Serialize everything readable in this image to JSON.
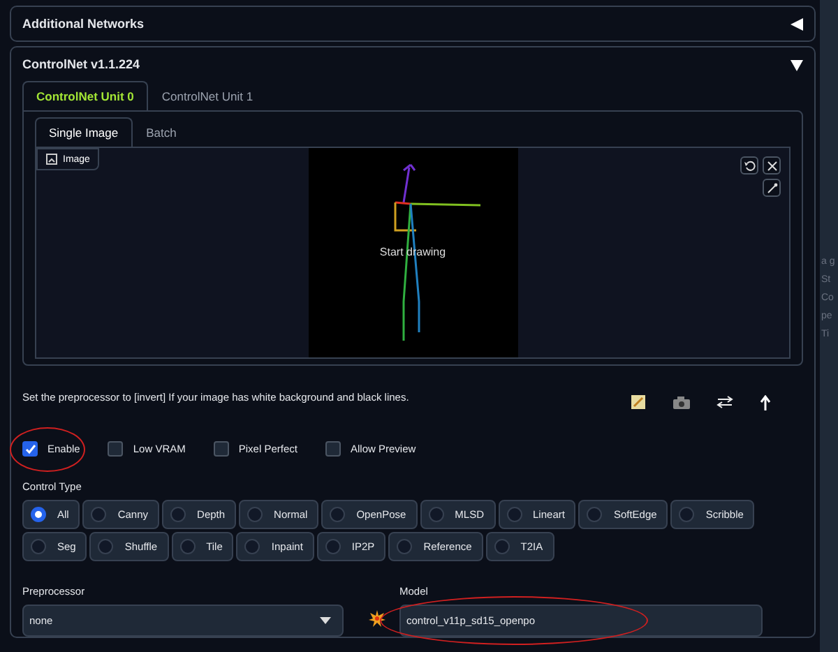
{
  "accordions": [
    {
      "title": "Additional Networks",
      "expanded": false
    },
    {
      "title": "ControlNet v1.1.224",
      "expanded": true
    }
  ],
  "unit_tabs": [
    {
      "label": "ControlNet Unit 0",
      "selected": true
    },
    {
      "label": "ControlNet Unit 1",
      "selected": false
    }
  ],
  "image_tabs": [
    {
      "label": "Single Image",
      "selected": true
    },
    {
      "label": "Batch",
      "selected": false
    }
  ],
  "image_panel": {
    "label": "Image",
    "canvas_text": "Start drawing"
  },
  "hint": "Set the preprocessor to [invert] If your image has white background and black lines.",
  "checkboxes": [
    {
      "label": "Enable",
      "checked": true
    },
    {
      "label": "Low VRAM",
      "checked": false
    },
    {
      "label": "Pixel Perfect",
      "checked": false
    },
    {
      "label": "Allow Preview",
      "checked": false
    }
  ],
  "control_type": {
    "label": "Control Type",
    "options": [
      {
        "label": "All",
        "selected": true
      },
      {
        "label": "Canny",
        "selected": false
      },
      {
        "label": "Depth",
        "selected": false
      },
      {
        "label": "Normal",
        "selected": false
      },
      {
        "label": "OpenPose",
        "selected": false
      },
      {
        "label": "MLSD",
        "selected": false
      },
      {
        "label": "Lineart",
        "selected": false
      },
      {
        "label": "SoftEdge",
        "selected": false
      },
      {
        "label": "Scribble",
        "selected": false
      },
      {
        "label": "Seg",
        "selected": false
      },
      {
        "label": "Shuffle",
        "selected": false
      },
      {
        "label": "Tile",
        "selected": false
      },
      {
        "label": "Inpaint",
        "selected": false
      },
      {
        "label": "IP2P",
        "selected": false
      },
      {
        "label": "Reference",
        "selected": false
      },
      {
        "label": "T2IA",
        "selected": false
      }
    ]
  },
  "preprocessor": {
    "label": "Preprocessor",
    "value": "none"
  },
  "model": {
    "label": "Model",
    "value": "control_v11p_sd15_openpo"
  },
  "side_panel": {
    "lines": [
      "a g",
      "St",
      "Co",
      "pe",
      "Ti"
    ]
  }
}
